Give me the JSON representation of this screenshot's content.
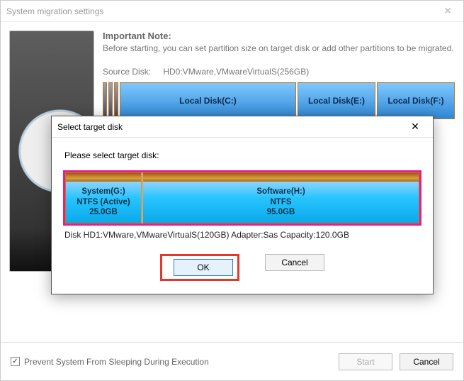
{
  "main": {
    "title": "System migration settings",
    "note_title": "Important Note:",
    "note_text": "Before starting, you can set partition size on target disk or add other partitions to be migrated.",
    "source_label": "Source Disk:",
    "source_value": "HD0:VMware,VMwareVirtualS(256GB)",
    "partitions": {
      "c": "Local Disk(C:)",
      "e": "Local Disk(E:)",
      "f": "Local Disk(F:)"
    },
    "footer": {
      "checkbox_label": "Prevent System From Sleeping During Execution",
      "start": "Start",
      "cancel": "Cancel"
    }
  },
  "modal": {
    "title": "Select target disk",
    "prompt": "Please select target disk:",
    "g": {
      "l1": "System(G:)",
      "l2": "NTFS (Active)",
      "l3": "25.0GB"
    },
    "h": {
      "l1": "Software(H:)",
      "l2": "NTFS",
      "l3": "95.0GB"
    },
    "diskinfo": "Disk HD1:VMware,VMwareVirtualS(120GB)  Adapter:Sas  Capacity:120.0GB",
    "ok": "OK",
    "cancel": "Cancel"
  }
}
